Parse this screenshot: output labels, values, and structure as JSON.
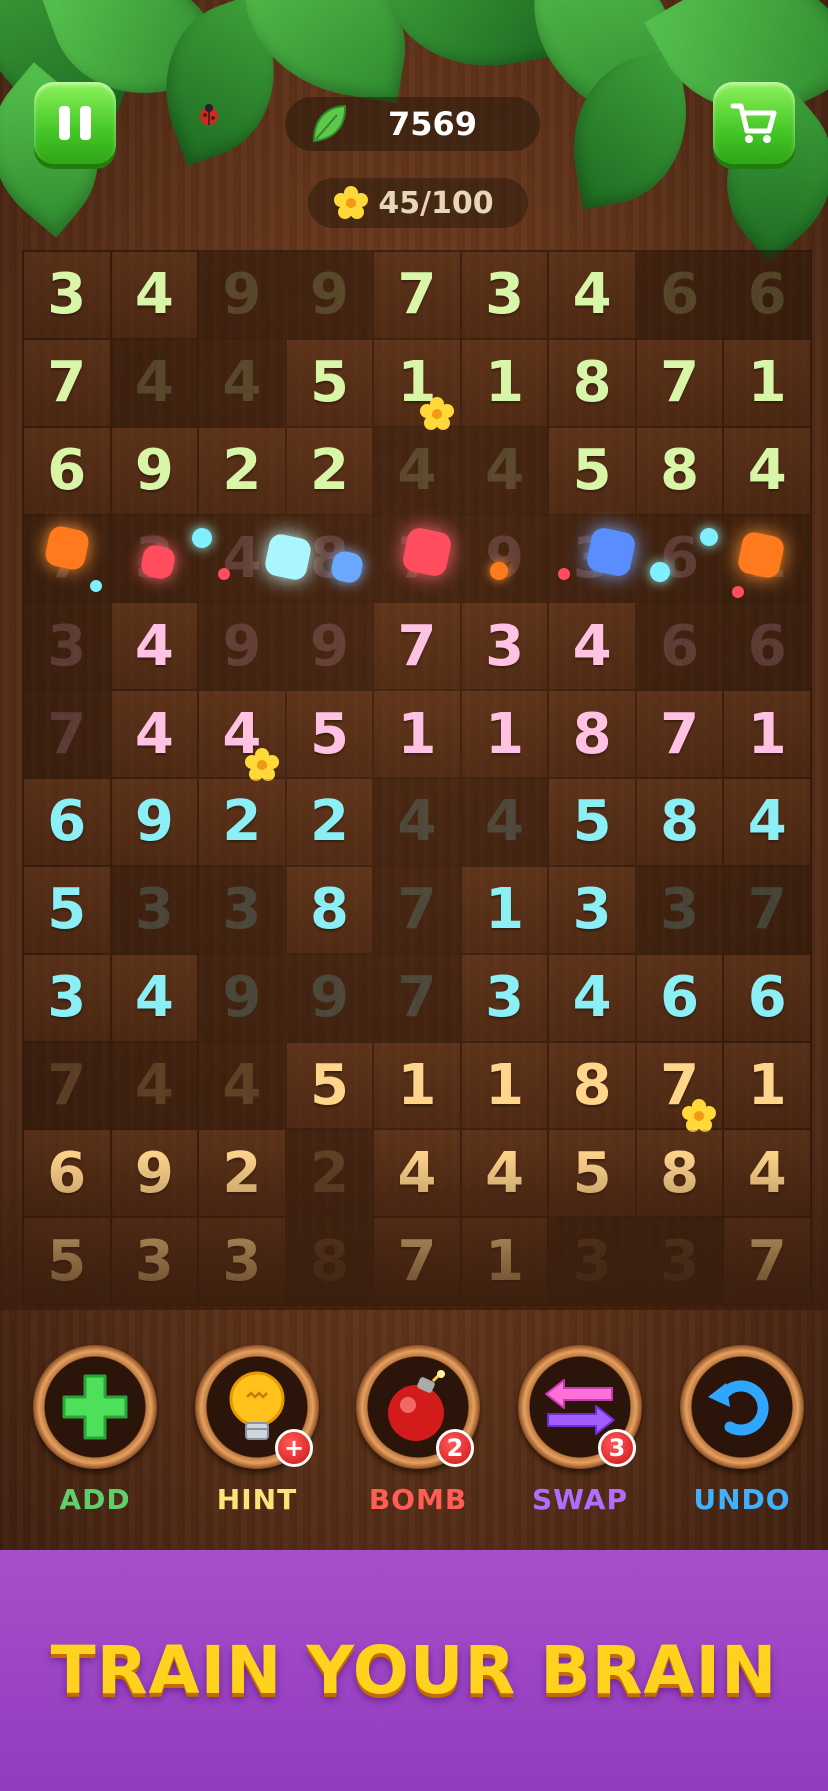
{
  "header": {
    "score": "7569",
    "flower_progress": "45/100"
  },
  "board": {
    "colors": {
      "green": "#d8f5a8",
      "pink": "#ffc2e2",
      "cyan": "#8af0f5",
      "amber": "#ffd58c"
    },
    "rows": [
      {
        "color": "green",
        "cells": [
          {
            "v": "3"
          },
          {
            "v": "4"
          },
          {
            "v": "9",
            "faded": true
          },
          {
            "v": "9",
            "faded": true
          },
          {
            "v": "7"
          },
          {
            "v": "3"
          },
          {
            "v": "4"
          },
          {
            "v": "6",
            "faded": true
          },
          {
            "v": "6",
            "faded": true
          }
        ]
      },
      {
        "color": "green",
        "cells": [
          {
            "v": "7"
          },
          {
            "v": "4",
            "faded": true
          },
          {
            "v": "4",
            "faded": true
          },
          {
            "v": "5"
          },
          {
            "v": "1",
            "flower": true
          },
          {
            "v": "1"
          },
          {
            "v": "8"
          },
          {
            "v": "7"
          },
          {
            "v": "1"
          }
        ]
      },
      {
        "color": "green",
        "cells": [
          {
            "v": "6"
          },
          {
            "v": "9"
          },
          {
            "v": "2"
          },
          {
            "v": "2"
          },
          {
            "v": "4",
            "faded": true
          },
          {
            "v": "4",
            "faded": true
          },
          {
            "v": "5"
          },
          {
            "v": "8"
          },
          {
            "v": "4"
          }
        ]
      },
      {
        "color": "pink",
        "cells": [
          {
            "v": "7",
            "faded": true
          },
          {
            "v": "3",
            "faded": true
          },
          {
            "v": "4",
            "faded": true
          },
          {
            "v": "8",
            "faded": true
          },
          {
            "v": "7",
            "faded": true
          },
          {
            "v": "9",
            "faded": true
          },
          {
            "v": "3",
            "faded": true
          },
          {
            "v": "6",
            "faded": true
          },
          {
            "v": "1",
            "faded": true
          }
        ]
      },
      {
        "color": "pink",
        "cells": [
          {
            "v": "3",
            "faded": true
          },
          {
            "v": "4"
          },
          {
            "v": "9",
            "faded": true
          },
          {
            "v": "9",
            "faded": true
          },
          {
            "v": "7"
          },
          {
            "v": "3"
          },
          {
            "v": "4"
          },
          {
            "v": "6",
            "faded": true
          },
          {
            "v": "6",
            "faded": true
          }
        ]
      },
      {
        "color": "pink",
        "cells": [
          {
            "v": "7",
            "faded": true
          },
          {
            "v": "4"
          },
          {
            "v": "4",
            "flower": true
          },
          {
            "v": "5"
          },
          {
            "v": "1"
          },
          {
            "v": "1"
          },
          {
            "v": "8"
          },
          {
            "v": "7"
          },
          {
            "v": "1"
          }
        ]
      },
      {
        "color": "cyan",
        "cells": [
          {
            "v": "6"
          },
          {
            "v": "9"
          },
          {
            "v": "2"
          },
          {
            "v": "2"
          },
          {
            "v": "4",
            "faded": true
          },
          {
            "v": "4",
            "faded": true
          },
          {
            "v": "5"
          },
          {
            "v": "8"
          },
          {
            "v": "4"
          }
        ]
      },
      {
        "color": "cyan",
        "cells": [
          {
            "v": "5"
          },
          {
            "v": "3",
            "faded": true
          },
          {
            "v": "3",
            "faded": true
          },
          {
            "v": "8"
          },
          {
            "v": "7",
            "faded": true
          },
          {
            "v": "1"
          },
          {
            "v": "3"
          },
          {
            "v": "3",
            "faded": true
          },
          {
            "v": "7",
            "faded": true
          }
        ]
      },
      {
        "color": "cyan",
        "cells": [
          {
            "v": "3"
          },
          {
            "v": "4"
          },
          {
            "v": "9",
            "faded": true
          },
          {
            "v": "9",
            "faded": true
          },
          {
            "v": "7",
            "faded": true
          },
          {
            "v": "3"
          },
          {
            "v": "4"
          },
          {
            "v": "6"
          },
          {
            "v": "6"
          }
        ]
      },
      {
        "color": "amber",
        "cells": [
          {
            "v": "7",
            "faded": true
          },
          {
            "v": "4",
            "faded": true
          },
          {
            "v": "4",
            "faded": true
          },
          {
            "v": "5"
          },
          {
            "v": "1"
          },
          {
            "v": "1"
          },
          {
            "v": "8"
          },
          {
            "v": "7",
            "flower": true
          },
          {
            "v": "1"
          }
        ]
      },
      {
        "color": "amber",
        "cells": [
          {
            "v": "6"
          },
          {
            "v": "9"
          },
          {
            "v": "2"
          },
          {
            "v": "2",
            "faded": true
          },
          {
            "v": "4"
          },
          {
            "v": "4"
          },
          {
            "v": "5"
          },
          {
            "v": "8"
          },
          {
            "v": "4"
          }
        ]
      },
      {
        "color": "amber",
        "cells": [
          {
            "v": "5"
          },
          {
            "v": "3"
          },
          {
            "v": "3"
          },
          {
            "v": "8",
            "faded": true
          },
          {
            "v": "7"
          },
          {
            "v": "1"
          },
          {
            "v": "3",
            "faded": true
          },
          {
            "v": "3",
            "faded": true
          },
          {
            "v": "7"
          }
        ]
      }
    ]
  },
  "tools": [
    {
      "id": "add",
      "label": "ADD",
      "color": "#5fcf6c",
      "icon": "plus-icon",
      "badge": ""
    },
    {
      "id": "hint",
      "label": "HINT",
      "color": "#ffe27a",
      "icon": "lightbulb-icon",
      "badge": "+"
    },
    {
      "id": "bomb",
      "label": "BOMB",
      "color": "#ff5d55",
      "icon": "bomb-icon",
      "badge": "2"
    },
    {
      "id": "swap",
      "label": "SWAP",
      "color": "#b46cff",
      "icon": "swap-arrows-icon",
      "badge": "3"
    },
    {
      "id": "undo",
      "label": "UNDO",
      "color": "#3fb2ff",
      "icon": "undo-arrow-icon",
      "badge": ""
    }
  ],
  "banner": {
    "text": "TRAIN YOUR BRAIN"
  }
}
